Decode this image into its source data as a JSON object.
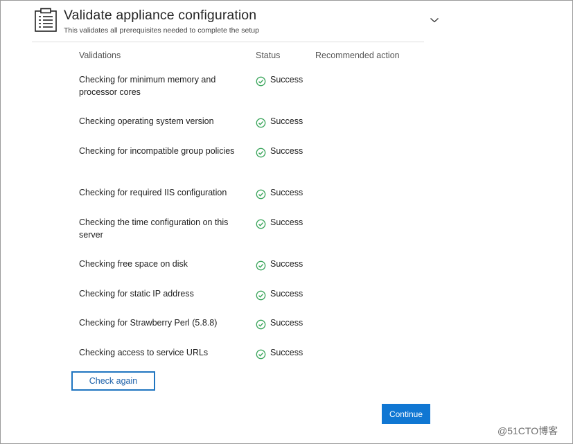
{
  "header": {
    "title": "Validate appliance configuration",
    "subtitle": "This validates all prerequisites needed to complete the setup",
    "icon": "clipboard-icon",
    "expand_icon": "chevron-down-icon"
  },
  "table": {
    "columns": [
      "Validations",
      "Status",
      "Recommended action"
    ],
    "rows": [
      {
        "validation": "Checking for minimum memory and processor cores",
        "status": "Success",
        "action": ""
      },
      {
        "validation": "Checking operating system version",
        "status": "Success",
        "action": ""
      },
      {
        "validation": "Checking for incompatible group policies",
        "status": "Success",
        "action": ""
      },
      {
        "validation": "Checking for required IIS configuration",
        "status": "Success",
        "action": ""
      },
      {
        "validation": "Checking the time configuration on this server",
        "status": "Success",
        "action": ""
      },
      {
        "validation": "Checking free space on disk",
        "status": "Success",
        "action": ""
      },
      {
        "validation": "Checking for static IP address",
        "status": "Success",
        "action": ""
      },
      {
        "validation": "Checking for Strawberry Perl (5.8.8)",
        "status": "Success",
        "action": ""
      },
      {
        "validation": "Checking access to service URLs",
        "status": "Success",
        "action": ""
      }
    ],
    "status_icon": "check-circle-icon"
  },
  "buttons": {
    "check_again": "Check again",
    "continue": "Continue"
  },
  "watermark": "@51CTO博客",
  "colors": {
    "accent": "#1077d3",
    "success": "#3aa55b",
    "outline_button": "#1f75c0"
  }
}
